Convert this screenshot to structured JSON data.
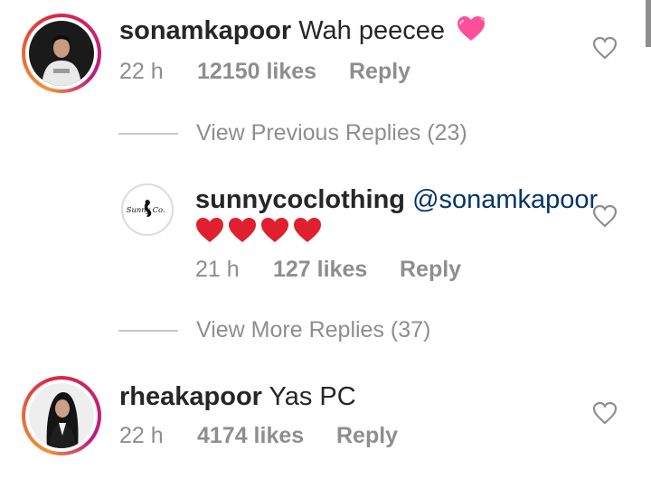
{
  "comments": [
    {
      "username": "sonamkapoor",
      "text": "Wah peecee",
      "time": "22 h",
      "likes": "12150 likes",
      "reply": "Reply"
    },
    {
      "username": "sunnycoclothing",
      "mention": "@sonamkapoor",
      "time": "21 h",
      "likes": "127 likes",
      "reply": "Reply",
      "logo_text_left": "Sunny",
      "logo_text_right": "Co."
    },
    {
      "username": "rheakapoor",
      "text": "Yas PC",
      "time": "22 h",
      "likes": "4174 likes",
      "reply": "Reply"
    }
  ],
  "view_previous": "View Previous Replies (23)",
  "view_more": "View More Replies (37)",
  "icons": {
    "like": "heart-outline-icon",
    "sparkle_heart": "sparkling-heart-emoji",
    "red_heart": "red-heart-emoji"
  },
  "colors": {
    "username": "#262626",
    "meta": "#8e8e8e",
    "mention": "#003569",
    "red_heart": "#e0202e",
    "pink_heart": "#ff4f9b"
  }
}
